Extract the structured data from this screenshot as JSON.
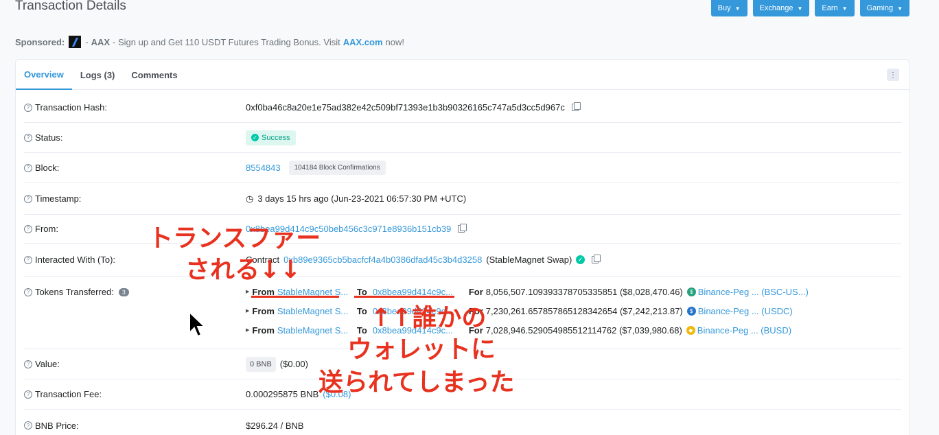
{
  "page_title": "Transaction Details",
  "top_buttons": [
    "Buy",
    "Exchange",
    "Earn",
    "Gaming"
  ],
  "sponsored": {
    "label": "Sponsored:",
    "brand": "AAX",
    "text": " - Sign up and Get 110 USDT Futures Trading Bonus. Visit ",
    "link": "AAX.com",
    "suffix": " now!"
  },
  "tabs": [
    "Overview",
    "Logs (3)",
    "Comments"
  ],
  "rows": {
    "hash": {
      "label": "Transaction Hash:",
      "value": "0xf0ba46c8a20e1e75ad382e42c509bf71393e1b3b90326165c747a5d3cc5d967c"
    },
    "status": {
      "label": "Status:",
      "value": "Success"
    },
    "block": {
      "label": "Block:",
      "value": "8554843",
      "confirmations": "104184 Block Confirmations"
    },
    "timestamp": {
      "label": "Timestamp:",
      "value": "3 days 15 hrs ago (Jun-23-2021 06:57:30 PM +UTC)"
    },
    "from": {
      "label": "From:",
      "value": "0x8bea99d414c9c50beb456c3c971e8936b151cb39"
    },
    "interacted": {
      "label": "Interacted With (To):",
      "prefix": "Contract",
      "address": "0xb89e9365cb5bacfcf4a4b0386dfad45c3b4d3258",
      "name": "(StableMagnet Swap)"
    },
    "tokens": {
      "label": "Tokens Transferred:",
      "count": "3",
      "transfers": [
        {
          "from_label": "From",
          "from": "StableMagnet S...",
          "to_label": "To",
          "to": "0x8bea99d414c9c...",
          "for_label": "For",
          "amount": "8,056,507.109393378705335851 ($8,028,470.46)",
          "token": "Binance-Peg ... (BSC-US...)",
          "icon_color": "#26a17b"
        },
        {
          "from_label": "From",
          "from": "StableMagnet S...",
          "to_label": "To",
          "to": "0x8bea99d414c9c...",
          "for_label": "For",
          "amount": "7,230,261.657857865128342654 ($7,242,213.87)",
          "token": "Binance-Peg ... (USDC)",
          "icon_color": "#2775ca"
        },
        {
          "from_label": "From",
          "from": "StableMagnet S...",
          "to_label": "To",
          "to": "0x8bea99d414c9c...",
          "for_label": "For",
          "amount": "7,028,946.529054985512114762 ($7,039,980.68)",
          "token": "Binance-Peg ... (BUSD)",
          "icon_color": "#f0b90b"
        }
      ]
    },
    "value": {
      "label": "Value:",
      "amount": "0 BNB",
      "usd": "($0.00)"
    },
    "fee": {
      "label": "Transaction Fee:",
      "value": "0.000295875 BNB",
      "usd": "($0.08)"
    },
    "price": {
      "label": "BNB Price:",
      "value": "$296.24 / BNB"
    }
  },
  "overlay": {
    "line1": "トランスファー",
    "line2": "される↓↓",
    "line3": "↑↑誰かの",
    "line4": "ウォレットに",
    "line5": "送られてしまった"
  },
  "colors": {
    "accent": "#3498db",
    "annotation": "#e8321f",
    "success": "#00c9a7"
  }
}
